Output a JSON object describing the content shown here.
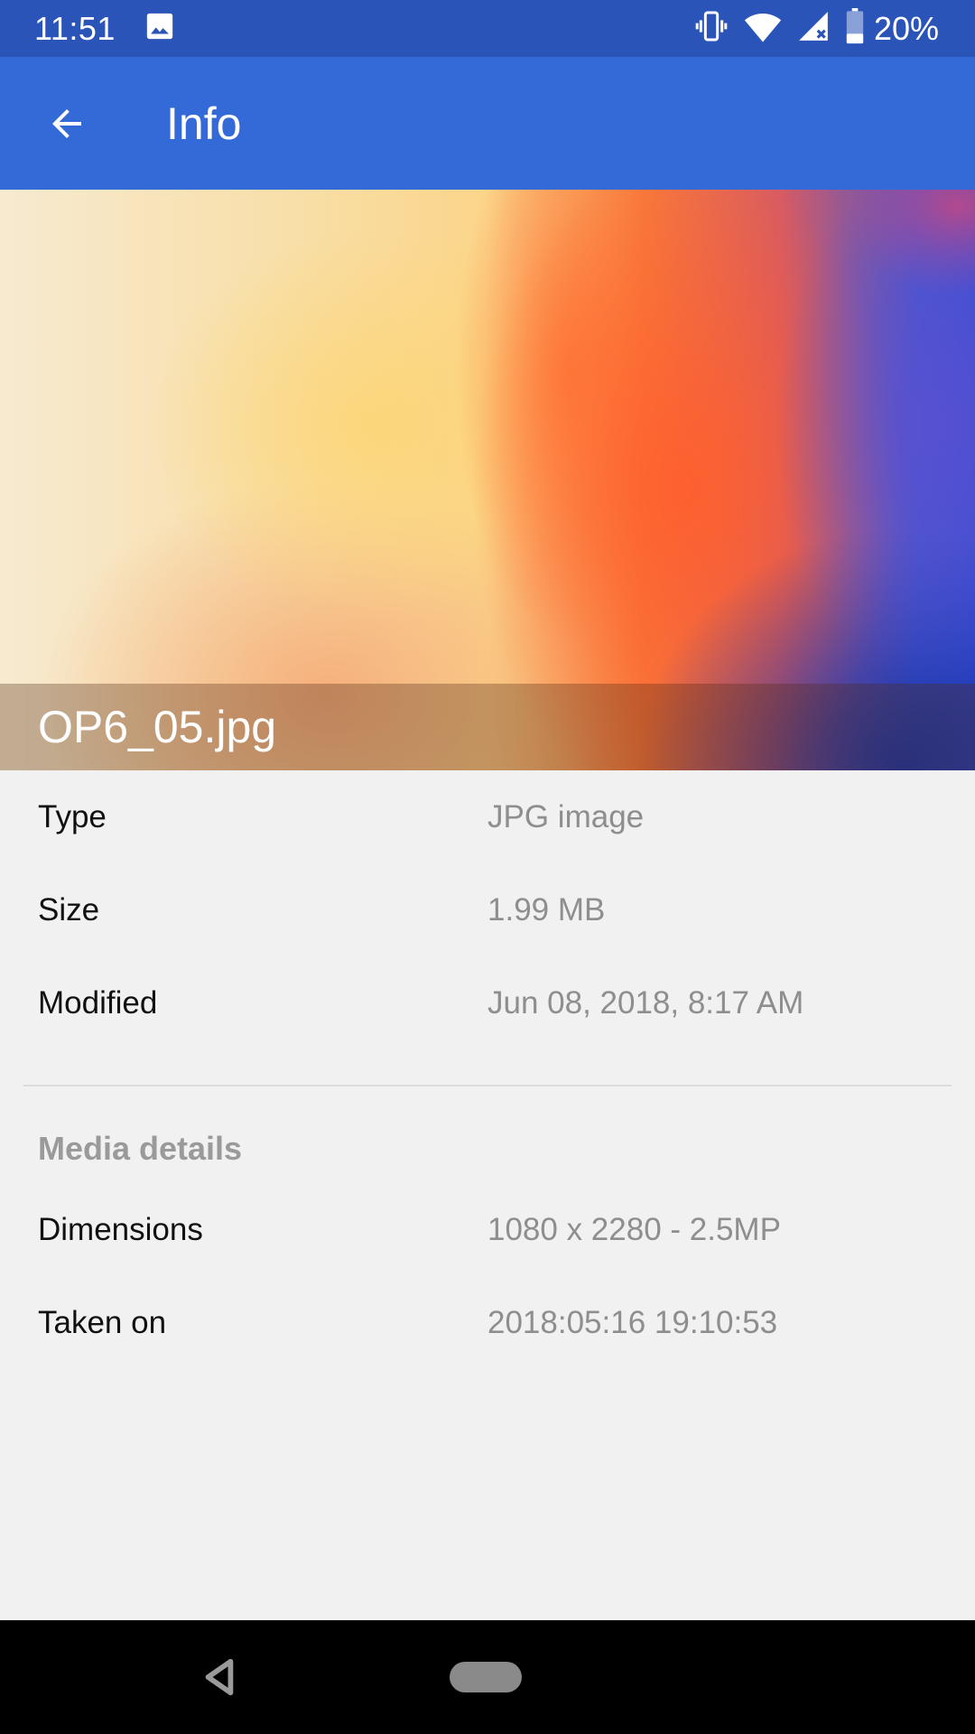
{
  "status_bar": {
    "time": "11:51",
    "battery_percent": "20%",
    "icons": [
      "image-icon",
      "vibrate-icon",
      "wifi-icon",
      "signal-icon",
      "battery-icon"
    ]
  },
  "app_bar": {
    "title": "Info",
    "back_icon": "arrow-back-icon",
    "color": "#346ad7"
  },
  "hero": {
    "file_name": "OP6_05.jpg"
  },
  "details": [
    {
      "label": "Type",
      "value": "JPG image"
    },
    {
      "label": "Size",
      "value": "1.99 MB"
    },
    {
      "label": "Modified",
      "value": "Jun 08, 2018, 8:17 AM"
    }
  ],
  "media_details": {
    "title": "Media details",
    "rows": [
      {
        "label": "Dimensions",
        "value": "1080 x 2280 - 2.5MP"
      },
      {
        "label": "Taken on",
        "value": "2018:05:16 19:10:53"
      }
    ]
  },
  "nav_bar": {
    "icons": [
      "nav-back-icon",
      "nav-home-pill"
    ]
  }
}
